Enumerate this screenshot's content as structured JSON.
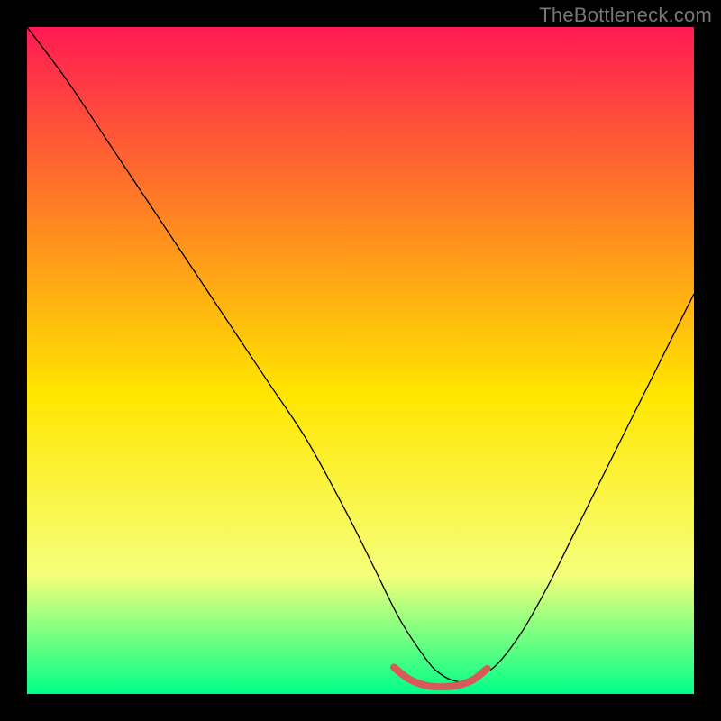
{
  "watermark": "TheBottleneck.com",
  "chart_data": {
    "type": "line",
    "title": "",
    "xlabel": "",
    "ylabel": "",
    "xlim": [
      0,
      100
    ],
    "ylim": [
      0,
      100
    ],
    "background_gradient": {
      "top": "#ff1a53",
      "mid_upper": "#ff8a1f",
      "mid": "#ffe600",
      "mid_lower": "#f6ff7a",
      "bottom": "#00ff88"
    },
    "series": [
      {
        "name": "curve",
        "color": "#000000",
        "stroke_width": 1.3,
        "x": [
          0,
          6,
          12,
          18,
          24,
          30,
          36,
          42,
          48,
          52,
          56,
          60,
          62,
          64,
          66,
          70,
          74,
          78,
          82,
          86,
          90,
          94,
          98,
          100
        ],
        "y": [
          100,
          92,
          83,
          74,
          65,
          56,
          47,
          38,
          27,
          19,
          11,
          5,
          3,
          2,
          2,
          4,
          9,
          16,
          24,
          32,
          40,
          48,
          56,
          60
        ]
      },
      {
        "name": "bottom-marker",
        "color": "#d65a5a",
        "stroke_width": 8,
        "linecap": "round",
        "x": [
          55,
          57,
          59,
          61,
          63,
          65,
          67,
          69
        ],
        "y": [
          4.0,
          2.4,
          1.5,
          1.1,
          1.1,
          1.4,
          2.2,
          3.8
        ]
      }
    ]
  }
}
